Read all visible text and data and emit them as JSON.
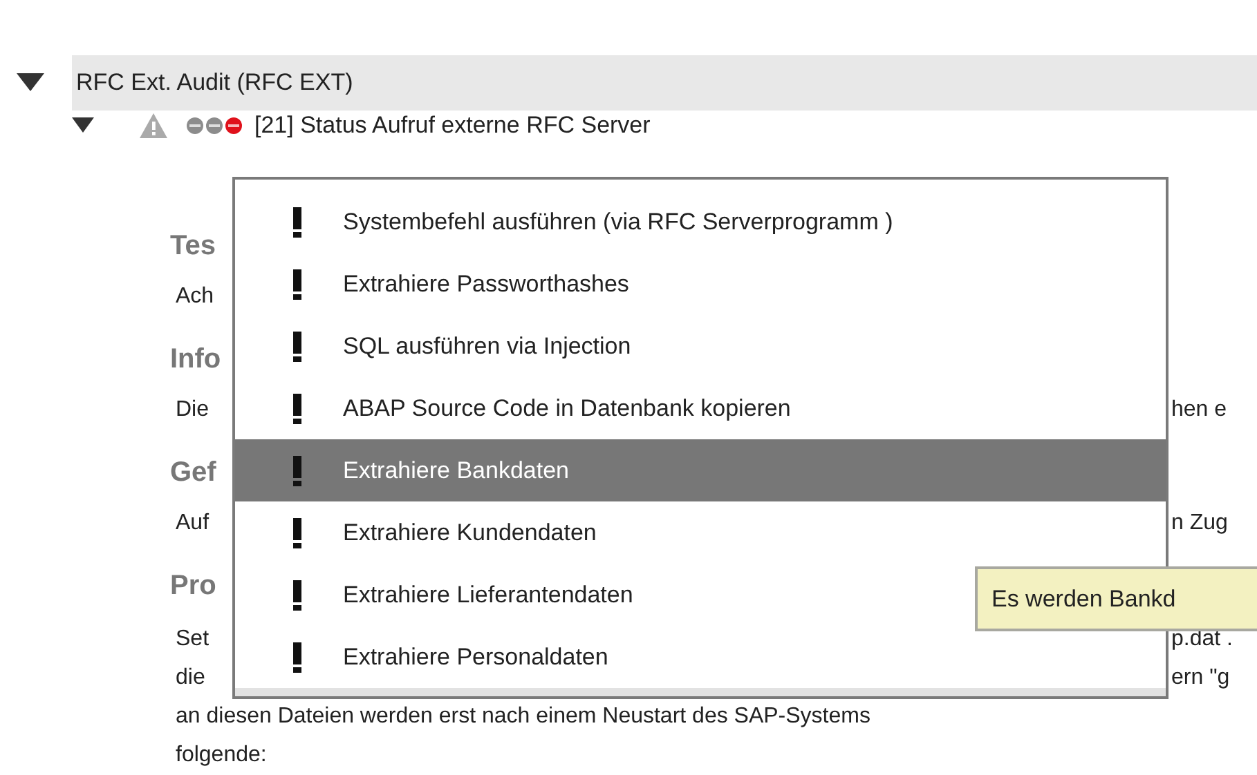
{
  "group": {
    "title": "RFC Ext. Audit (RFC EXT)",
    "expanded": true
  },
  "check": {
    "title": "[21] Status Aufruf externe RFC Server",
    "expanded": true,
    "status_dots": [
      {
        "color": "#8c8c8c"
      },
      {
        "color": "#8c8c8c"
      },
      {
        "color": "#e0111b"
      }
    ]
  },
  "sections": [
    {
      "heading": "Tes",
      "lines": [
        {
          "kind": "split",
          "left": "Ach"
        }
      ]
    },
    {
      "heading": "Info",
      "lines": [
        {
          "kind": "split",
          "left": "Die",
          "right": "hen e"
        }
      ]
    },
    {
      "heading": "Gef",
      "lines": [
        {
          "kind": "split",
          "left": "Auf",
          "right": "n Zug"
        }
      ]
    },
    {
      "heading": "Pro",
      "lines": [
        {
          "kind": "split",
          "left": "Set",
          "right": "p.dat ."
        },
        {
          "kind": "split",
          "left": "die",
          "right": "ern \"g"
        },
        {
          "kind": "full",
          "text": "an diesen Dateien werden erst nach einem Neustart des SAP-Systems"
        },
        {
          "kind": "full",
          "text": "folgende:"
        }
      ]
    }
  ],
  "menu": {
    "items": [
      {
        "label": "Systembefehl ausführen (via RFC Serverprogramm )",
        "selected": false
      },
      {
        "label": "Extrahiere Passworthashes",
        "selected": false
      },
      {
        "label": "SQL ausführen via Injection",
        "selected": false
      },
      {
        "label": "ABAP Source Code in Datenbank kopieren",
        "selected": false
      },
      {
        "label": "Extrahiere Bankdaten",
        "selected": true
      },
      {
        "label": "Extrahiere Kundendaten",
        "selected": false
      },
      {
        "label": "Extrahiere Lieferantendaten",
        "selected": false
      },
      {
        "label": "Extrahiere Personaldaten",
        "selected": false
      }
    ]
  },
  "tooltip": {
    "text": "Es werden Bankd"
  }
}
